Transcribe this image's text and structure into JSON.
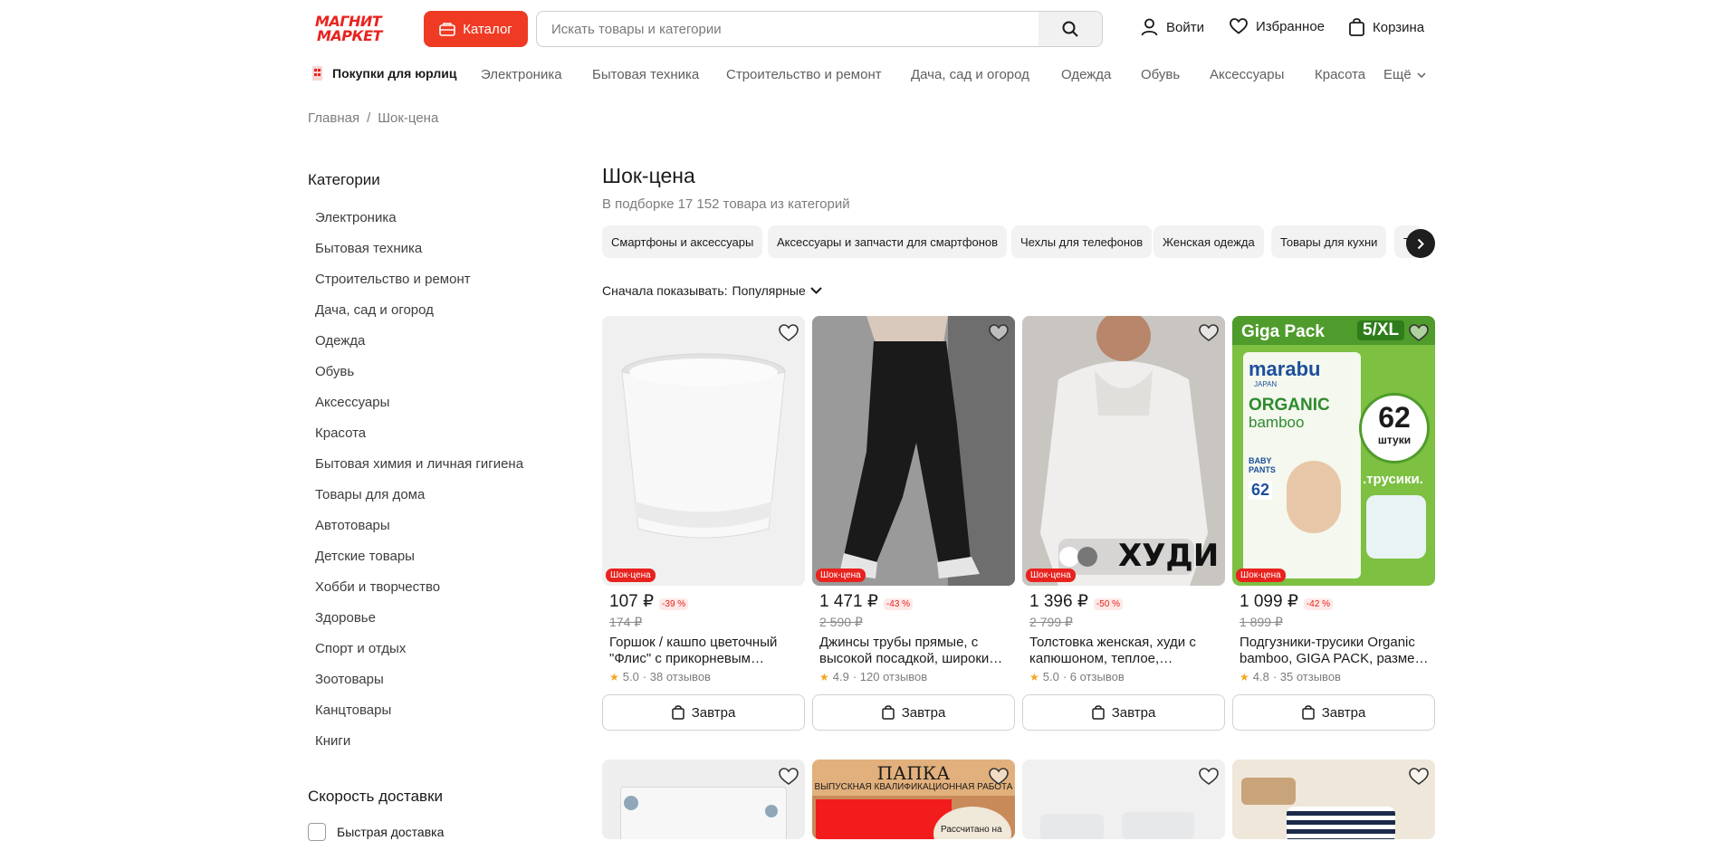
{
  "header": {
    "logo_line1": "МАГНИТ",
    "logo_line2": "МАРКЕТ",
    "catalog_label": "Каталог",
    "search_placeholder": "Искать товары и категории",
    "login": "Войти",
    "favorites": "Избранное",
    "cart": "Корзина"
  },
  "nav": {
    "legal": "Покупки для юрлиц",
    "items": [
      "Электроника",
      "Бытовая техника",
      "Строительство и ремонт",
      "Дача, сад и огород",
      "Одежда",
      "Обувь",
      "Аксессуары",
      "Красота"
    ],
    "more": "Ещё"
  },
  "breadcrumb": {
    "home": "Главная",
    "sep": "/",
    "current": "Шок-цена"
  },
  "sidebar": {
    "title": "Категории",
    "items": [
      "Электроника",
      "Бытовая техника",
      "Строительство и ремонт",
      "Дача, сад и огород",
      "Одежда",
      "Обувь",
      "Аксессуары",
      "Красота",
      "Бытовая химия и личная гигиена",
      "Товары для дома",
      "Автотовары",
      "Детские товары",
      "Хобби и творчество",
      "Здоровье",
      "Спорт и отдых",
      "Зоотовары",
      "Канцтовары",
      "Книги"
    ],
    "speed_title": "Скорость доставки",
    "fast_delivery": "Быстрая доставка"
  },
  "main": {
    "title": "Шок-цена",
    "subtitle": "В подборке 17 152 товара из категорий",
    "chips": [
      "Смартфоны и аксессуары",
      "Аксессуары и запчасти для смартфонов",
      "Чехлы для телефонов",
      "Женская одежда",
      "Товары для кухни",
      "Т"
    ],
    "sort_label": "Сначала показывать:",
    "sort_value": "Популярные"
  },
  "products": [
    {
      "badge": "Шок-цена",
      "price": "107 ₽",
      "discount": "-39 %",
      "old_price": "174 ₽",
      "name1": "Горшок / кашпо цветочный",
      "name2": "\"Флис\" с прикорневым…",
      "rating": "5.0",
      "reviews": "· 38 отзывов",
      "delivery": "Завтра"
    },
    {
      "badge": "Шок-цена",
      "price": "1 471 ₽",
      "discount": "-43 %",
      "old_price": "2 590 ₽",
      "name1": "Джинсы трубы прямые, с",
      "name2": "высокой посадкой, широки…",
      "rating": "4.9",
      "reviews": "· 120 отзывов",
      "delivery": "Завтра"
    },
    {
      "badge": "Шок-цена",
      "price": "1 396 ₽",
      "discount": "-50 %",
      "old_price": "2 799 ₽",
      "name1": "Толстовка женская, худи с",
      "name2": "капюшоном, теплое,…",
      "rating": "5.0",
      "reviews": "· 6 отзывов",
      "delivery": "Завтра",
      "img_text": "ХУДИ"
    },
    {
      "badge": "Шок-цена",
      "price": "1 099 ₽",
      "discount": "-42 %",
      "old_price": "1 899 ₽",
      "name1": "Подгузники-трусики Organic",
      "name2": "bamboo, GIGA PACK, разме…",
      "rating": "4.8",
      "reviews": "· 35 отзывов",
      "delivery": "Завтра",
      "img_title": "Giga Pack",
      "img_size": "5/XL",
      "img_brand": "marabu",
      "img_brand_sub": "JAPAN",
      "img_line1": "ORGANIC",
      "img_line2": "bamboo",
      "img_count": "62",
      "img_count_label": "штуки",
      "img_tag": ".трусики.",
      "img_pants": "BABY PANTS",
      "img_pants_num": "62"
    }
  ],
  "row2": {
    "folder_title": "ПАПКА",
    "folder_sub": "ВЫПУСКНАЯ КВАЛИФИКАЦИОННАЯ РАБОТА",
    "folder_sticker": "Рассчитано на"
  },
  "colors": {
    "brand": "#e8231f",
    "catalog": "#ef3b24"
  }
}
